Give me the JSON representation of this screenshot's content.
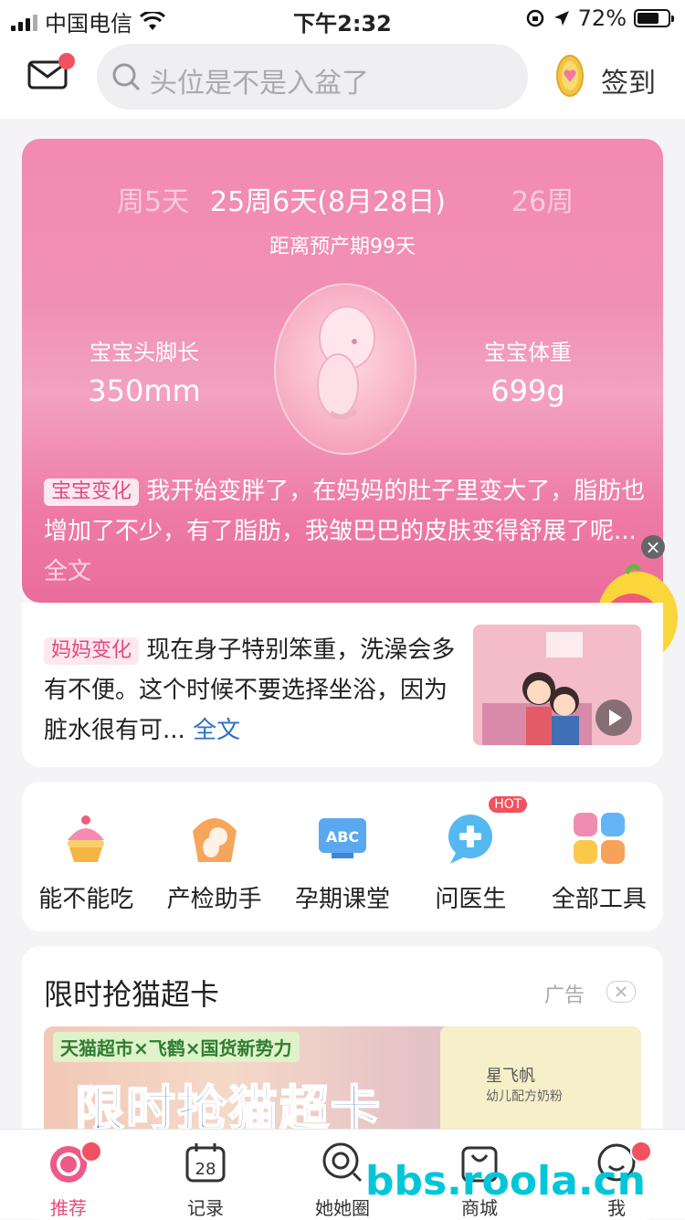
{
  "status_bar": {
    "carrier": "中国电信",
    "time": "下午2:32",
    "battery": "72%",
    "battery_level": 0.72
  },
  "header": {
    "search_placeholder": "头位是不是入盆了",
    "signin_label": "签到"
  },
  "hero": {
    "week_prev": "周5天",
    "week_current": "25周6天(8月28日)",
    "week_next": "26周",
    "due_text": "距离预产期99天",
    "left_label": "宝宝头脚长",
    "left_value": "350mm",
    "right_label": "宝宝体重",
    "right_value": "699g",
    "baby_badge": "宝宝变化",
    "baby_text": "我开始变胖了，在妈妈的肚子里变大了，脂肪也增加了不少，有了脂肪，我皱巴巴的皮肤变得舒展了呢...",
    "baby_more": "全文"
  },
  "mom": {
    "badge": "妈妈变化",
    "text": "现在身子特别笨重，洗澡会多有不便。这个时候不要选择坐浴，因为脏水很有可...",
    "more": "全文"
  },
  "tools": [
    {
      "label": "能不能吃",
      "icon": "cupcake-icon"
    },
    {
      "label": "产检助手",
      "icon": "fetus-icon"
    },
    {
      "label": "孕期课堂",
      "icon": "abc-board-icon"
    },
    {
      "label": "问医生",
      "icon": "doctor-chat-icon",
      "badge": "HOT"
    },
    {
      "label": "全部工具",
      "icon": "grid-icon"
    }
  ],
  "ad_card": {
    "title": "限时抢猫超卡",
    "ad_label": "广告",
    "banner_brands": "天猫超市×飞鹤×国货新势力",
    "banner_headline": "限时抢猫超卡",
    "can_brand": "星飞帆",
    "can_sub": "幼儿配方奶粉"
  },
  "tabbar": [
    {
      "label": "推荐",
      "icon": "home-fruit-icon",
      "active": true
    },
    {
      "label": "记录",
      "icon": "calendar-icon",
      "day": "28"
    },
    {
      "label": "她她圈",
      "icon": "community-icon"
    },
    {
      "label": "商城",
      "icon": "shop-bag-icon"
    },
    {
      "label": "我",
      "icon": "profile-icon"
    }
  ],
  "watermark": "bbs.roola.cn",
  "colors": {
    "accent": "#e94b7a",
    "hero_pink": "#f090b2",
    "link_blue": "#2d6fc9",
    "badge_red": "#f0525f"
  }
}
